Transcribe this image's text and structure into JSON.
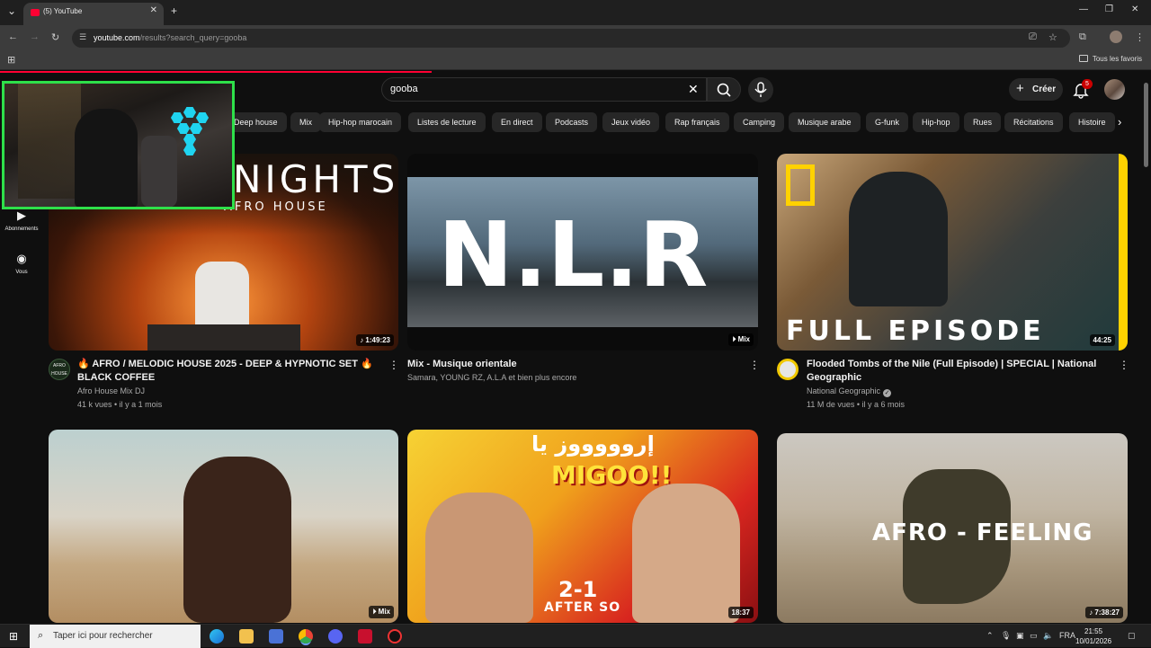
{
  "browser": {
    "tab_title": "(5) YouTube",
    "url_host": "youtube.com",
    "url_rest": "/results?search_query=gooba",
    "bookmarks_label": "Tous les favoris"
  },
  "youtube": {
    "search_query": "gooba",
    "create_label": "Créer",
    "notification_count": "5",
    "chips": [
      "Deep house",
      "Mix",
      "Hip-hop marocain",
      "Listes de lecture",
      "En direct",
      "Podcasts",
      "Jeux vidéo",
      "Rap français",
      "Camping",
      "Musique arabe",
      "G-funk",
      "Hip-hop",
      "Rues",
      "Récitations",
      "Histoire"
    ],
    "sidebar": [
      {
        "label": "Abonnements",
        "icon": "subscriptions-icon"
      },
      {
        "label": "Vous",
        "icon": "you-icon"
      }
    ],
    "videos": [
      {
        "title": "🔥 AFRO / MELODIC HOUSE 2025 - DEEP & HYPNOTIC SET 🔥 BLACK COFFEE",
        "channel": "Afro House Mix DJ",
        "meta": "41 k vues • il y a 1 mois",
        "duration": "♪ 1:49:23",
        "thumb_text": "NIGHTS",
        "thumb_sub": "AFRO HOUSE",
        "channel_avatar_text": "AFRO HOUSE"
      },
      {
        "title": "Mix - Musique orientale",
        "channel": "Samara, YOUNG RZ, A.L.A et bien plus encore",
        "duration": "⏵ Mix",
        "thumb_text": "N.L.R"
      },
      {
        "title": "Flooded Tombs of the Nile (Full Episode) | SPECIAL | National Geographic",
        "channel": "National Geographic",
        "meta": "11 M de vues • il y a 6 mois",
        "duration": "44:25",
        "thumb_text": "FULL EPISODE"
      },
      {
        "duration": "⏵ Mix"
      },
      {
        "duration": "18:37",
        "thumb_text": "MIGOO!!",
        "thumb_arabic": "إروووووز يا",
        "thumb_score": "2-1",
        "thumb_sub": "AFTER SO"
      },
      {
        "duration": "♪ 7:38:27",
        "thumb_text": "AFRO - FEELING"
      }
    ]
  },
  "taskbar": {
    "search_placeholder": "Taper ici pour rechercher",
    "lang": "FRA",
    "time": "21:55",
    "date": "10/01/2026"
  },
  "colors": {
    "accent": "#ff0033",
    "webcam_border": "#2ee04a",
    "background": "#0f0f0f"
  }
}
